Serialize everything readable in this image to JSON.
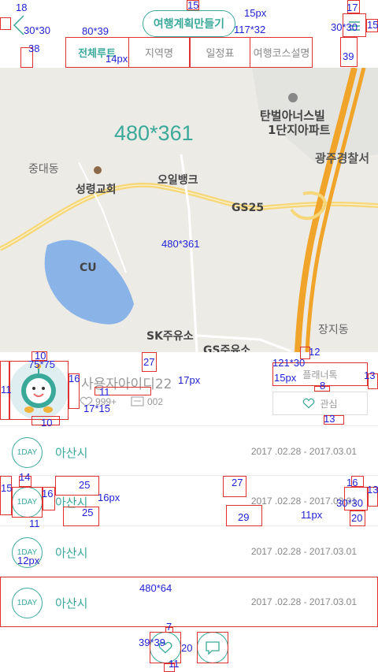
{
  "header": {
    "plan_button": "여행계획만들기",
    "tabs": [
      "전체루트",
      "지역명",
      "일정표",
      "여행코스설명"
    ]
  },
  "map": {
    "size_label": "480*361",
    "size_label_small": "480*361",
    "places": [
      "탄벌아너스빌",
      "1단지아파트",
      "광주경찰서",
      "중대동",
      "성령교회",
      "오일뱅크",
      "GS25",
      "CU",
      "SK주유소",
      "GS주유소",
      "장지동"
    ]
  },
  "profile": {
    "user_id": "사용자아이디22",
    "likes": "999+",
    "comments": "002",
    "planner_talk": "플래너톡",
    "interest": "관심"
  },
  "days": [
    {
      "badge": "1DAY",
      "city": "아산시",
      "dates": "2017 .02.28  -  2017.03.01"
    },
    {
      "badge": "1DAY",
      "city": "아산시",
      "dates": "2017 .02.28  -  2017.03.01"
    },
    {
      "badge": "1DAY",
      "city": "아산시",
      "dates": "2017 .02.28  -  2017.03.01"
    },
    {
      "badge": "1DAY",
      "city": "아산시",
      "dates": "2017 .02.28  -  2017.03.01"
    }
  ],
  "annotations": {
    "a1": "18",
    "a2": "30*30",
    "a3": "38",
    "a4": "15",
    "a5": "15px",
    "a6": "117*32",
    "a7": "80*39",
    "a8": "14px",
    "a9": "17",
    "a10": "30*30",
    "a11": "15",
    "a12": "39",
    "a13": "10",
    "a14": "75*75",
    "a15": "27",
    "a16": "17px",
    "a17": "12",
    "a18": "121*30",
    "a19": "15px",
    "a20": "13",
    "a21": "8",
    "a22": "11",
    "a23": "16",
    "a24": "11",
    "a25": "17*15",
    "a26": "10",
    "a27": "13",
    "a28": "14",
    "a29": "25",
    "a30": "27",
    "a31": "16",
    "a32": "15",
    "a33": "16",
    "a34": "16px",
    "a35": "13",
    "a36": "30*30",
    "a37": "25",
    "a38": "29",
    "a39": "11px",
    "a40": "20",
    "a41": "11",
    "a42": "12px",
    "a43": "480*64",
    "a44": "7",
    "a45": "39*39",
    "a46": "20",
    "a47": "11"
  },
  "colors": {
    "accent": "#3ba99a",
    "annotation_box": "#e0302f",
    "annotation_text": "#1f1fd6"
  }
}
